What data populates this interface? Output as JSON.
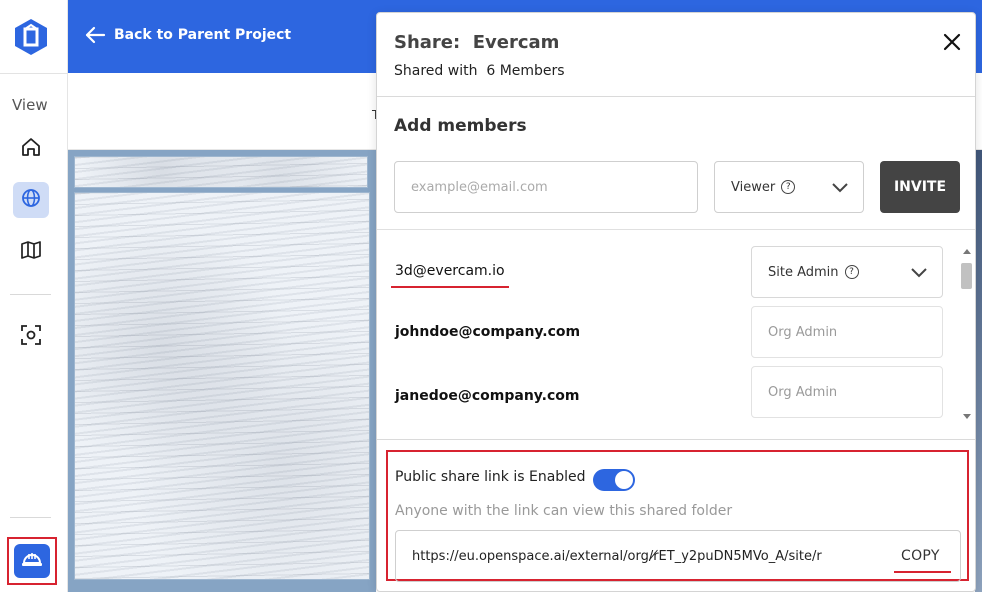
{
  "app": {
    "back_label": "Back to Parent Project",
    "view_label": "View",
    "tiny_char": "T",
    "brand_color": "#2d66e0",
    "icons": [
      "app-logo",
      "home-icon",
      "globe-icon",
      "map-icon",
      "focus-icon",
      "helmet-icon"
    ]
  },
  "share": {
    "title": "Share:  Evercam",
    "shared_with": "Shared with  6 Members",
    "add_members": "Add members",
    "email_placeholder": "example@email.com",
    "role_selected": "Viewer",
    "invite_label": "INVITE",
    "members": [
      {
        "email": "3d@evercam.io",
        "role": "Site Admin"
      },
      {
        "email": "johndoe@company.com",
        "role": "Org Admin"
      },
      {
        "email": "janedoe@company.com",
        "role": "Org Admin"
      }
    ],
    "public_link": {
      "label": "Public share link is Enabled",
      "enabled": true,
      "description": "Anyone with the link can view this shared folder",
      "url": "https://eu.openspace.ai/external/org/r‍̸ET_y2puDN5MVo_A/site/r",
      "copy_label": "COPY"
    }
  }
}
